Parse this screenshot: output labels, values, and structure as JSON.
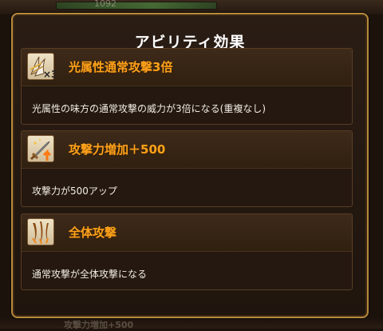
{
  "background": {
    "hp_value": "1092",
    "bottom_text": "攻撃力増加+500"
  },
  "popup": {
    "title": "アビリティ効果"
  },
  "abilities": [
    {
      "name": "光属性通常攻撃3倍",
      "description": "光属性の味方の通常攻撃の威力が3倍になる(重複なし)",
      "icon": "claw-x3-icon",
      "icon_badge": "×3"
    },
    {
      "name": "攻撃力増加＋500",
      "description": "攻撃力が500アップ",
      "icon": "sword-up-icon"
    },
    {
      "name": "全体攻撃",
      "description": "通常攻撃が全体攻撃になる",
      "icon": "triple-slash-icon"
    }
  ],
  "colors": {
    "ability_name": "#ffa21a",
    "frame_gold": "#b98a3c",
    "card_bg": "#241810"
  }
}
